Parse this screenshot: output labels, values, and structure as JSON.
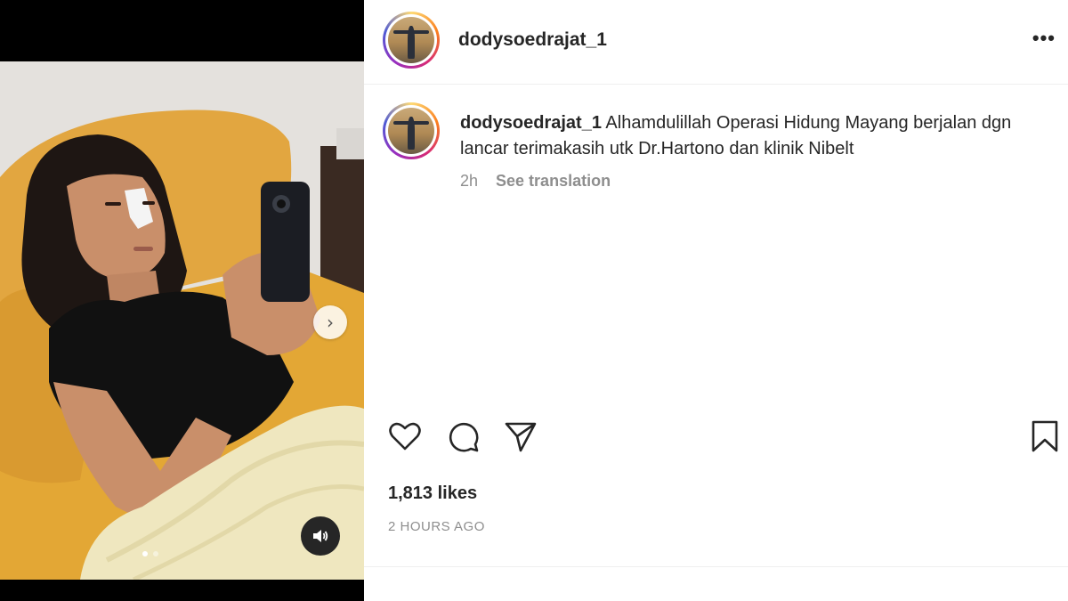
{
  "post": {
    "username": "dodysoedrajat_1",
    "more_label": "•••",
    "caption_user": "dodysoedrajat_1",
    "caption_text": "Alhamdulillah Operasi Hidung Mayang berjalan dgn lancar terimakasih utk Dr.Hartono dan klinik Nibelt",
    "time_short": "2h",
    "see_translation": "See translation",
    "likes": "1,813 likes",
    "time_long": "2 HOURS AGO"
  },
  "media": {
    "next_glyph": "›",
    "carousel_count": 2,
    "carousel_active": 1
  },
  "icons": {
    "like": "heart-icon",
    "comment": "comment-icon",
    "share": "share-icon",
    "save": "bookmark-icon",
    "mute": "speaker-icon",
    "next": "chevron-right-icon"
  }
}
